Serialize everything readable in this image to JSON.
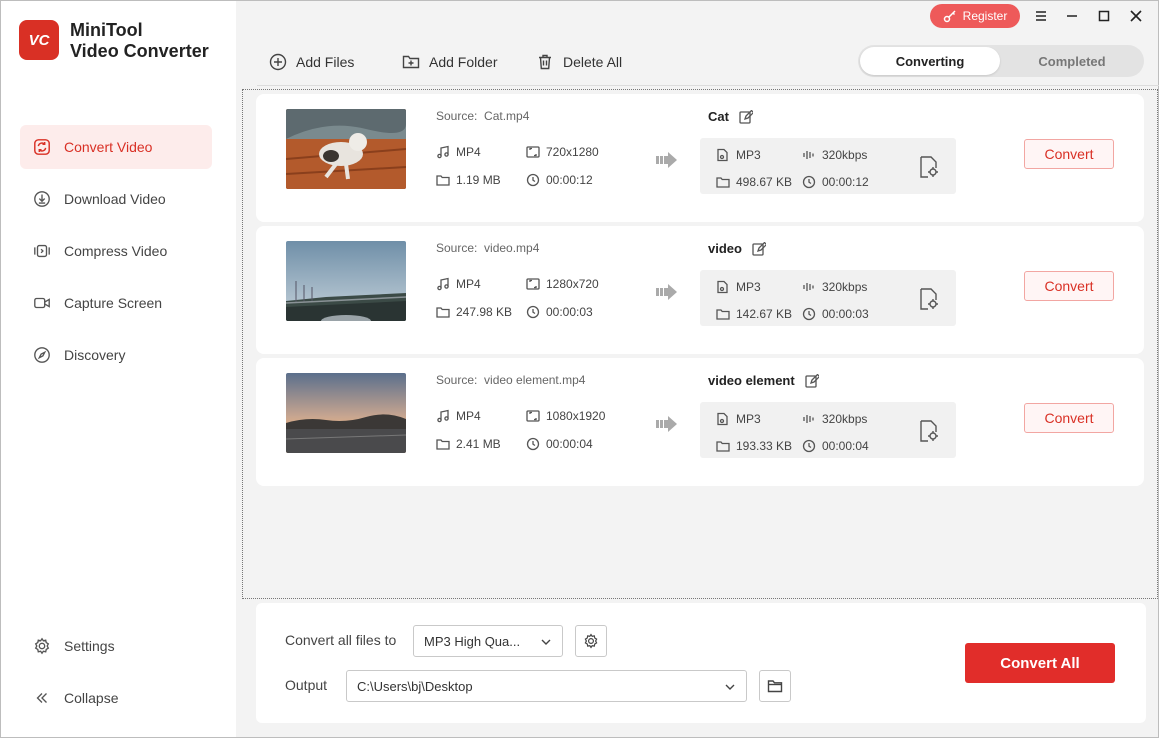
{
  "app": {
    "logo_text": "VC",
    "name_line1": "MiniTool",
    "name_line2": "Video Converter",
    "brand_color": "#d93025"
  },
  "titlebar": {
    "register_label": "Register"
  },
  "sidebar": {
    "items": [
      {
        "label": "Convert Video",
        "icon": "convert-icon",
        "active": true
      },
      {
        "label": "Download Video",
        "icon": "download-icon"
      },
      {
        "label": "Compress Video",
        "icon": "compress-icon"
      },
      {
        "label": "Capture Screen",
        "icon": "camera-icon"
      },
      {
        "label": "Discovery",
        "icon": "compass-icon"
      }
    ],
    "bottom_items": [
      {
        "label": "Settings",
        "icon": "gear-icon"
      },
      {
        "label": "Collapse",
        "icon": "collapse-icon"
      }
    ]
  },
  "toolbar": {
    "add_files": "Add Files",
    "add_folder": "Add Folder",
    "delete_all": "Delete All",
    "tabs": [
      {
        "label": "Converting",
        "active": true
      },
      {
        "label": "Completed",
        "active": false
      }
    ]
  },
  "files": [
    {
      "source_label": "Source:",
      "source": "Cat.mp4",
      "format": "MP4",
      "resolution": "720x1280",
      "size": "1.19 MB",
      "duration": "00:00:12",
      "output_name": "Cat",
      "out_format": "MP3",
      "out_bitrate": "320kbps",
      "out_size": "498.67 KB",
      "out_duration": "00:00:12",
      "convert_label": "Convert"
    },
    {
      "source_label": "Source:",
      "source": "video.mp4",
      "format": "MP4",
      "resolution": "1280x720",
      "size": "247.98 KB",
      "duration": "00:00:03",
      "output_name": "video",
      "out_format": "MP3",
      "out_bitrate": "320kbps",
      "out_size": "142.67 KB",
      "out_duration": "00:00:03",
      "convert_label": "Convert"
    },
    {
      "source_label": "Source:",
      "source": "video element.mp4",
      "format": "MP4",
      "resolution": "1080x1920",
      "size": "2.41 MB",
      "duration": "00:00:04",
      "output_name": "video element",
      "out_format": "MP3",
      "out_bitrate": "320kbps",
      "out_size": "193.33 KB",
      "out_duration": "00:00:04",
      "convert_label": "Convert"
    }
  ],
  "bottom": {
    "convert_all_to_label": "Convert all files to",
    "format_value": "MP3 High Qua...",
    "output_label": "Output",
    "output_path": "C:\\Users\\bj\\Desktop",
    "convert_all_label": "Convert All"
  }
}
